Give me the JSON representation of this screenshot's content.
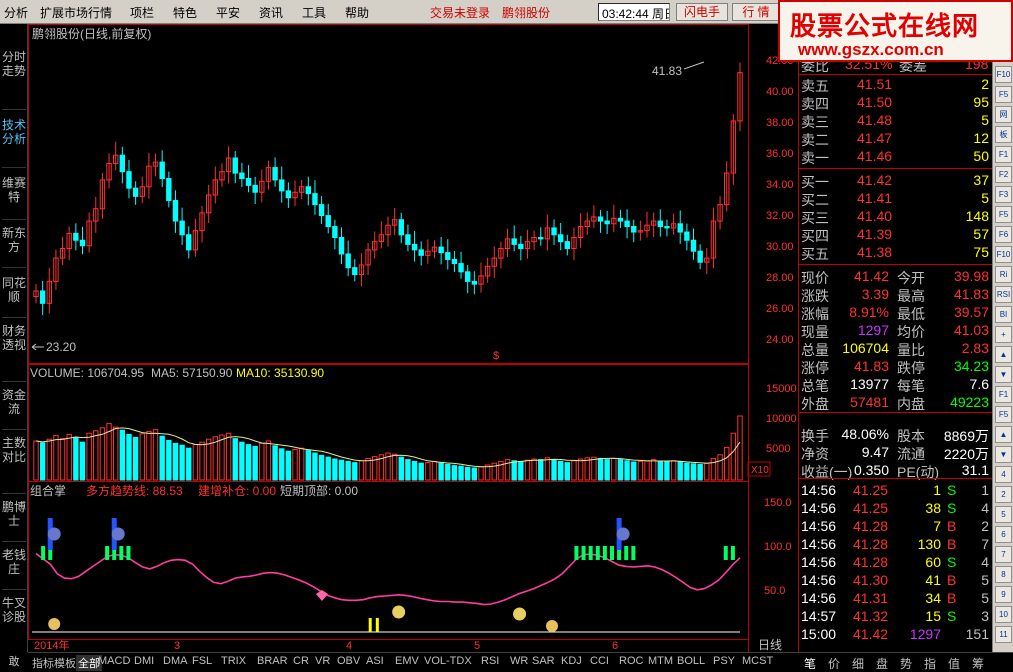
{
  "menu": {
    "items": [
      "分析",
      "扩展市场行情",
      "项栏",
      "特色",
      "平安",
      "资讯",
      "工具",
      "帮助"
    ],
    "status": "交易未登录",
    "stock": "鹏翎股份",
    "time": "03:42:44 周日",
    "btn_flash": "闪电手",
    "btn_quote": "行 情"
  },
  "logo": {
    "line1": "股票公式在线网",
    "line2": "www.gszx.com.cn"
  },
  "left_tabs": [
    {
      "label": "分时走势",
      "active": false
    },
    {
      "label": "技术分析",
      "active": true
    },
    {
      "label": "维赛特",
      "active": false
    },
    {
      "label": "新东方",
      "active": false
    },
    {
      "label": "同花顺",
      "active": false
    },
    {
      "label": "财务透视",
      "active": false
    },
    {
      "label": "资金流",
      "active": false
    },
    {
      "label": "主数对比",
      "active": false
    },
    {
      "label": "鹏博士",
      "active": false
    },
    {
      "label": "老钱庄",
      "active": false
    },
    {
      "label": "牛叉诊股",
      "active": false
    },
    {
      "label": "敢",
      "active": false
    }
  ],
  "chart": {
    "title": "鹏翎股份(日线,前复权)",
    "price_axis": [
      "42.00",
      "40.00",
      "38.00",
      "36.00",
      "34.00",
      "32.00",
      "30.00",
      "28.00",
      "26.00",
      "24.00"
    ],
    "high_label": "41.83",
    "low_label": "23.20",
    "vol_header": {
      "label": "VOLUME: 106704.95",
      "ma5": "MA5: 57150.90",
      "ma10": "MA10: 35130.90"
    },
    "vol_axis": [
      "15000",
      "10000",
      "5000"
    ],
    "vol_unit": "X10",
    "ind_header": {
      "name": "组合掌",
      "l1": "多方趋势线: 88.53",
      "l2": "建增补仓: 0.00",
      "l3": "短期顶部: 0.00"
    },
    "ind_axis": [
      "150.0",
      "100.0",
      "50.0"
    ],
    "date_year": "2014年",
    "month_marks": [
      "3",
      "4",
      "5",
      "6"
    ],
    "period": "日线"
  },
  "chart_data": {
    "type": "candlestick",
    "title": "鹏翎股份(日线,前复权)",
    "ylim": [
      22,
      43
    ],
    "high": 41.83,
    "low": 23.2,
    "closes": [
      25.5,
      24.6,
      26.2,
      27.9,
      28.6,
      29.7,
      29.2,
      28.8,
      30.6,
      31.5,
      33.6,
      34.8,
      35.4,
      34.2,
      33.0,
      32.4,
      33.1,
      34.6,
      34.9,
      33.7,
      32.1,
      30.6,
      29.6,
      28.5,
      29.9,
      31.2,
      32.5,
      33.6,
      34.2,
      35.2,
      34.1,
      33.7,
      33.2,
      32.7,
      33.5,
      34.5,
      33.6,
      32.8,
      32.3,
      32.7,
      33.1,
      32.6,
      31.8,
      31.0,
      30.2,
      29.4,
      28.2,
      27.2,
      26.7,
      27.4,
      28.5,
      29.1,
      29.6,
      30.3,
      30.7,
      29.6,
      28.9,
      28.5,
      28.1,
      28.4,
      28.7,
      28.3,
      27.8,
      27.5,
      26.9,
      26.2,
      26.0,
      26.6,
      27.3,
      27.9,
      28.6,
      29.3,
      28.9,
      28.6,
      29.1,
      29.4,
      29.3,
      30.1,
      29.6,
      29.1,
      28.6,
      29.4,
      30.2,
      30.6,
      30.9,
      30.6,
      30.4,
      30.8,
      30.6,
      30.2,
      29.8,
      29.9,
      30.3,
      30.6,
      30.2,
      30.1,
      30.4,
      29.8,
      29.2,
      28.4,
      27.6,
      27.9,
      30.6,
      31.8,
      34.1,
      37.9,
      41.42
    ],
    "vol_values": [
      6500,
      6200,
      6800,
      7400,
      6900,
      7600,
      7100,
      6300,
      7800,
      8200,
      8700,
      9400,
      8800,
      8300,
      7600,
      7100,
      7700,
      8100,
      8400,
      7300,
      6600,
      6100,
      5800,
      5300,
      5900,
      6300,
      6800,
      7200,
      7500,
      7800,
      6900,
      6300,
      5900,
      5600,
      6100,
      6500,
      5700,
      5200,
      4800,
      5100,
      5300,
      4900,
      4500,
      4100,
      3800,
      3500,
      3300,
      3100,
      2900,
      3200,
      3600,
      3900,
      4200,
      4500,
      4300,
      3800,
      3400,
      3100,
      2800,
      2900,
      3100,
      2800,
      2600,
      2400,
      2300,
      2100,
      2000,
      2200,
      2500,
      2800,
      3100,
      3400,
      3200,
      3000,
      3300,
      3500,
      3400,
      3700,
      3400,
      3100,
      2900,
      3200,
      3500,
      3700,
      3800,
      3600,
      3400,
      3600,
      3400,
      3200,
      3000,
      3100,
      3200,
      3400,
      3100,
      3000,
      3200,
      3000,
      2800,
      2700,
      2600,
      2800,
      3600,
      4200,
      5400,
      7800,
      10670
    ],
    "ma_line": [
      95,
      86,
      78,
      62,
      55,
      54,
      58,
      66,
      74,
      82,
      90,
      93,
      92,
      88,
      80,
      73,
      70,
      74,
      80,
      84,
      85,
      84,
      78,
      66,
      56,
      48,
      46,
      50,
      55,
      57,
      58,
      60,
      63,
      64,
      63,
      60,
      56,
      52,
      47,
      41,
      34,
      27,
      23,
      20,
      19,
      19,
      20,
      23,
      25,
      26,
      27,
      28,
      27,
      25,
      22,
      20,
      18,
      17,
      17,
      16,
      16,
      15,
      14,
      12,
      13,
      16,
      20,
      25,
      30,
      34,
      38,
      43,
      48,
      54,
      62,
      74,
      86,
      93,
      94,
      92,
      88,
      82,
      76,
      74,
      73,
      74,
      75,
      73,
      69,
      63,
      56,
      48,
      40,
      36,
      38,
      44,
      52,
      64,
      77,
      88
    ]
  },
  "quote": {
    "partial_row": {
      "label": "委比",
      "value": "32.51%",
      "label2": "委差",
      "value2": "198"
    },
    "asks": [
      {
        "label": "卖五",
        "price": "41.51",
        "vol": "2"
      },
      {
        "label": "卖四",
        "price": "41.50",
        "vol": "95"
      },
      {
        "label": "卖三",
        "price": "41.48",
        "vol": "5"
      },
      {
        "label": "卖二",
        "price": "41.47",
        "vol": "12"
      },
      {
        "label": "卖一",
        "price": "41.46",
        "vol": "50"
      }
    ],
    "bids": [
      {
        "label": "买一",
        "price": "41.42",
        "vol": "37"
      },
      {
        "label": "买二",
        "price": "41.41",
        "vol": "5"
      },
      {
        "label": "买三",
        "price": "41.40",
        "vol": "148"
      },
      {
        "label": "买四",
        "price": "41.39",
        "vol": "57"
      },
      {
        "label": "买五",
        "price": "41.38",
        "vol": "75"
      }
    ],
    "stats": [
      {
        "l1": "现价",
        "v1": "41.42",
        "c1": "#ff3030",
        "l2": "今开",
        "v2": "39.98",
        "c2": "#ff3030"
      },
      {
        "l1": "涨跌",
        "v1": "3.39",
        "c1": "#ff3030",
        "l2": "最高",
        "v2": "41.83",
        "c2": "#ff3030"
      },
      {
        "l1": "涨幅",
        "v1": "8.91%",
        "c1": "#ff3030",
        "l2": "最低",
        "v2": "39.57",
        "c2": "#ff3030"
      },
      {
        "l1": "现量",
        "v1": "1297",
        "c1": "#cc33ff",
        "l2": "均价",
        "v2": "41.03",
        "c2": "#ff3030"
      },
      {
        "l1": "总量",
        "v1": "106704",
        "c1": "#ffff00",
        "l2": "量比",
        "v2": "2.83",
        "c2": "#ff3030"
      },
      {
        "l1": "涨停",
        "v1": "41.83",
        "c1": "#ff3030",
        "l2": "跌停",
        "v2": "34.23",
        "c2": "#00ff00"
      },
      {
        "l1": "总笔",
        "v1": "13977",
        "c1": "#ffffff",
        "l2": "每笔",
        "v2": "7.6",
        "c2": "#ffffff"
      },
      {
        "l1": "外盘",
        "v1": "57481",
        "c1": "#ff3030",
        "l2": "内盘",
        "v2": "49223",
        "c2": "#00ff00"
      },
      {
        "l1": "换手",
        "v1": "48.06%",
        "c1": "#ffffff",
        "l2": "股本",
        "v2": "8869万",
        "c2": "#ffffff"
      },
      {
        "l1": "净资",
        "v1": "9.47",
        "c1": "#ffffff",
        "l2": "流通",
        "v2": "2220万",
        "c2": "#ffffff"
      },
      {
        "l1": "收益(一)",
        "v1": "0.350",
        "c1": "#ffffff",
        "l2": "PE(动)",
        "v2": "31.1",
        "c2": "#ffffff"
      }
    ],
    "trades": [
      {
        "time": "14:56",
        "price": "41.25",
        "vol": "1",
        "side": "S",
        "n": "1",
        "vc": "#ffff00"
      },
      {
        "time": "14:56",
        "price": "41.25",
        "vol": "38",
        "side": "S",
        "n": "4",
        "vc": "#ffff00"
      },
      {
        "time": "14:56",
        "price": "41.28",
        "vol": "7",
        "side": "B",
        "n": "2",
        "vc": "#ffff00"
      },
      {
        "time": "14:56",
        "price": "41.28",
        "vol": "130",
        "side": "B",
        "n": "7",
        "vc": "#ffff00"
      },
      {
        "time": "14:56",
        "price": "41.28",
        "vol": "60",
        "side": "S",
        "n": "4",
        "vc": "#ffff00"
      },
      {
        "time": "14:56",
        "price": "41.30",
        "vol": "41",
        "side": "B",
        "n": "5",
        "vc": "#ffff00"
      },
      {
        "time": "14:56",
        "price": "41.31",
        "vol": "34",
        "side": "B",
        "n": "5",
        "vc": "#ffff00"
      },
      {
        "time": "14:57",
        "price": "41.32",
        "vol": "15",
        "side": "S",
        "n": "3",
        "vc": "#ffff00"
      },
      {
        "time": "15:00",
        "price": "41.42",
        "vol": "1297",
        "side": "",
        "n": "151",
        "vc": "#cc33ff"
      }
    ]
  },
  "right_icons": [
    "F10",
    "F5",
    "网",
    "板",
    "F1",
    "F2",
    "F3",
    "F5",
    "F6",
    "F10",
    "Ri",
    "RSI",
    "BI",
    "+",
    "▲",
    "▼",
    "F1",
    "F5",
    "▲",
    "▼",
    "4",
    "2",
    "5",
    "6",
    "7",
    "8",
    "9",
    "10",
    "11"
  ],
  "bottom_tabs": [
    "指标",
    "模板",
    "全部",
    "MACD",
    "DMI",
    "DMA",
    "FSL",
    "TRIX",
    "BRAR",
    "CR",
    "VR",
    "OBV",
    "ASI",
    "EMV",
    "VOL-TDX",
    "RSI",
    "WR",
    "SAR",
    "KDJ",
    "CCI",
    "ROC",
    "MTM",
    "BOLL",
    "PSY",
    "MCST"
  ],
  "left_bottom": "敢",
  "right_bottom_tabs": [
    "笔",
    "价",
    "细",
    "盘",
    "势",
    "指",
    "值",
    "筹"
  ],
  "colors": {
    "up": "#ff3030",
    "down": "#00ffff",
    "ma": "#e8e8a0",
    "ind_line": "#ff3ca0",
    "grid": "#c00000",
    "accent_blue": "#4fc3f7"
  }
}
